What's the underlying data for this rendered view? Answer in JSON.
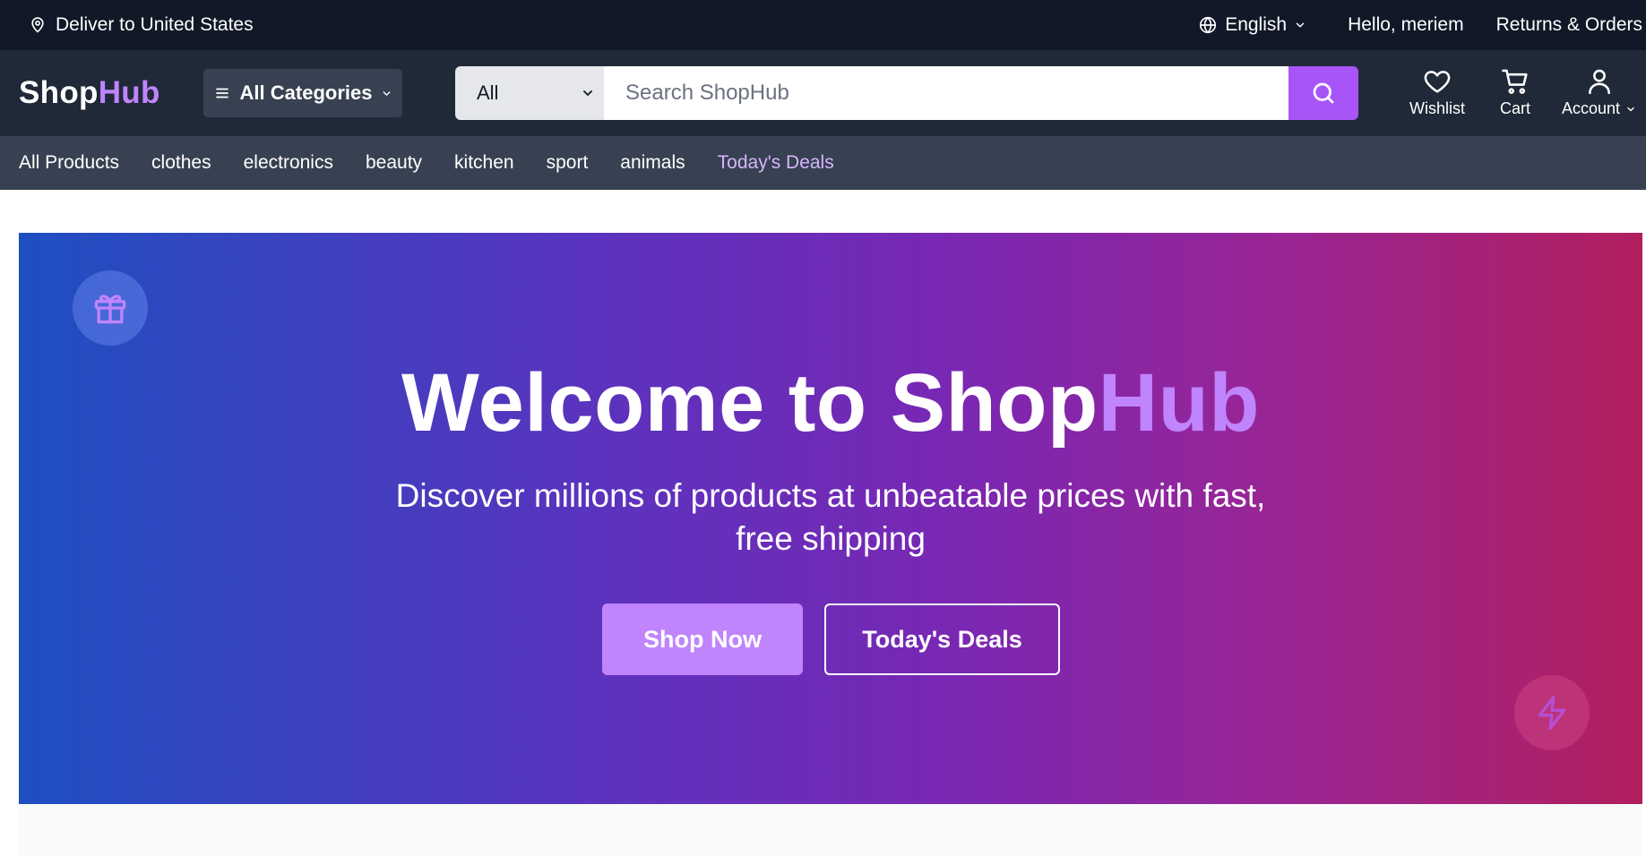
{
  "topbar": {
    "deliver_text": "Deliver to United States",
    "language": "English",
    "greeting": "Hello, meriem",
    "returns_orders": "Returns & Orders"
  },
  "header": {
    "logo": {
      "part1": "Shop",
      "part2": "Hub"
    },
    "all_categories": "All Categories",
    "search": {
      "category_selected": "All",
      "placeholder": "Search ShopHub",
      "value": ""
    },
    "wishlist_label": "Wishlist",
    "cart_label": "Cart",
    "account_label": "Account"
  },
  "nav": {
    "items": [
      "All Products",
      "clothes",
      "electronics",
      "beauty",
      "kitchen",
      "sport",
      "animals",
      "Today's Deals"
    ]
  },
  "hero": {
    "title_part1": "Welcome to Shop",
    "title_part2": "Hub",
    "subtitle": "Discover millions of products at unbeatable prices with fast, free shipping",
    "shop_now": "Shop Now",
    "todays_deals": "Today's Deals"
  },
  "icons": [
    "location-pin-icon",
    "globe-icon",
    "chevron-down-icon",
    "menu-icon",
    "search-icon",
    "heart-icon",
    "cart-icon",
    "user-icon",
    "gift-icon",
    "bolt-icon"
  ],
  "colors": {
    "topbar_bg": "#111827",
    "header_bg": "#1f2937",
    "nav_bg": "#374151",
    "accent": "#a855f7",
    "accent_light": "#c084fc",
    "deal_link": "#d8b4fe",
    "hero_gradient_start": "#1e4fc0",
    "hero_gradient_end": "#b11f5e"
  }
}
